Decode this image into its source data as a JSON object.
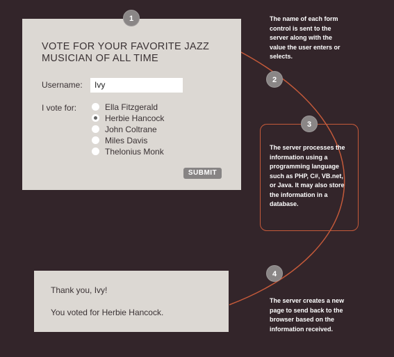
{
  "form": {
    "title": "VOTE FOR YOUR FAVORITE JAZZ MUSICIAN OF ALL TIME",
    "username_label": "Username:",
    "username_value": "Ivy",
    "vote_label": "I vote for:",
    "options": [
      {
        "label": "Ella Fitzgerald",
        "checked": false
      },
      {
        "label": "Herbie Hancock",
        "checked": true
      },
      {
        "label": "John Coltrane",
        "checked": false
      },
      {
        "label": "Miles Davis",
        "checked": false
      },
      {
        "label": "Thelonius Monk",
        "checked": false
      }
    ],
    "submit_label": "SUBMIT"
  },
  "steps": [
    "1",
    "2",
    "3",
    "4"
  ],
  "notes": {
    "step2": "The name of each form control is sent to the server along with the value the user enters or selects.",
    "step3": "The server processes the information using a programming language such as PHP, C#, VB.net, or Java. It may also store the information in a database.",
    "step4": "The server creates a new page to send back to the browser based on the information received."
  },
  "result": {
    "thanks": "Thank you, Ivy!",
    "voted": "You voted for Herbie Hancock."
  },
  "colors": {
    "background": "#33252a",
    "panel": "#dcd8d3",
    "connector": "#c55a3a",
    "badge": "#8a8686"
  }
}
